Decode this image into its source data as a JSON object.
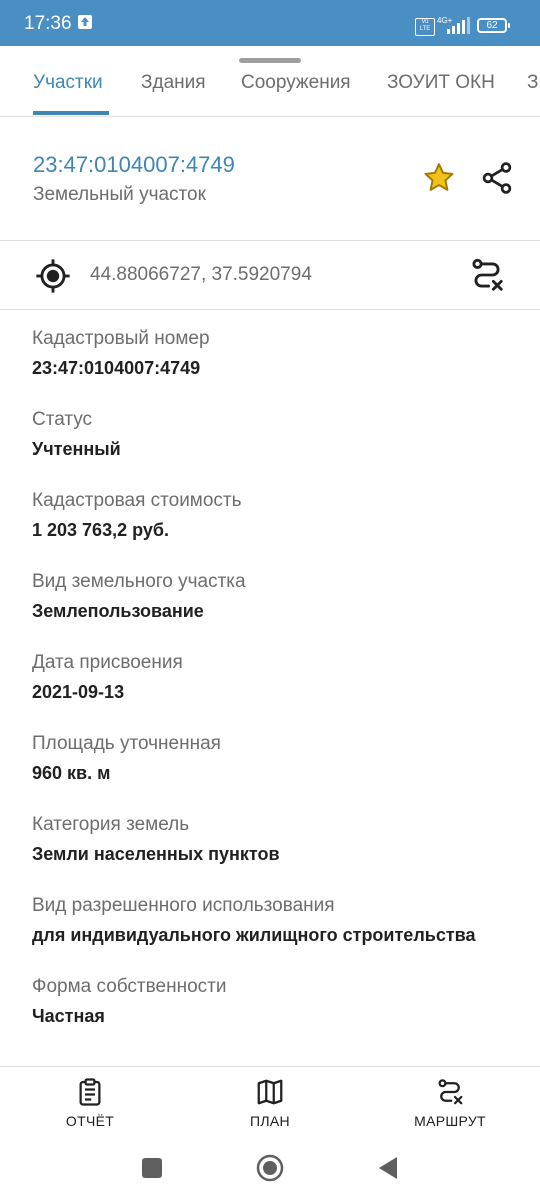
{
  "status_bar": {
    "time": "17:36",
    "volte": "Vo LTE",
    "network": "4G+",
    "battery": "62"
  },
  "tabs": [
    {
      "label": "Участки",
      "active": true
    },
    {
      "label": "Здания",
      "active": false
    },
    {
      "label": "Сооружения",
      "active": false
    },
    {
      "label": "ЗОУИТ ОКН",
      "active": false
    },
    {
      "label": "З",
      "active": false
    }
  ],
  "header": {
    "cadastral_number": "23:47:0104007:4749",
    "object_type": "Земельный участок",
    "favorite_icon": "star-icon",
    "share_icon": "share-icon"
  },
  "location": {
    "coordinates": "44.88066727, 37.5920794",
    "locate_icon": "target-icon",
    "route_icon": "route-cancel-icon"
  },
  "properties": [
    {
      "label": "Кадастровый номер",
      "value": "23:47:0104007:4749"
    },
    {
      "label": "Статус",
      "value": "Учтенный"
    },
    {
      "label": "Кадастровая стоимость",
      "value": "1 203 763,2 руб."
    },
    {
      "label": "Вид земельного участка",
      "value": "Землепользование"
    },
    {
      "label": "Дата присвоения",
      "value": "2021-09-13"
    },
    {
      "label": "Площадь уточненная",
      "value": "960 кв. м"
    },
    {
      "label": "Категория земель",
      "value": "Земли населенных пунктов"
    },
    {
      "label": "Вид разрешенного использования",
      "value": "для индивидуального жилищного строительства"
    },
    {
      "label": "Форма собственности",
      "value": "Частная"
    }
  ],
  "bottom_nav": {
    "report": "ОТЧЁТ",
    "plan": "ПЛАН",
    "route": "МАРШРУТ"
  },
  "colors": {
    "accent": "#3d86b6",
    "status_bar": "#4a8fc3",
    "star": "#f2c21b"
  }
}
